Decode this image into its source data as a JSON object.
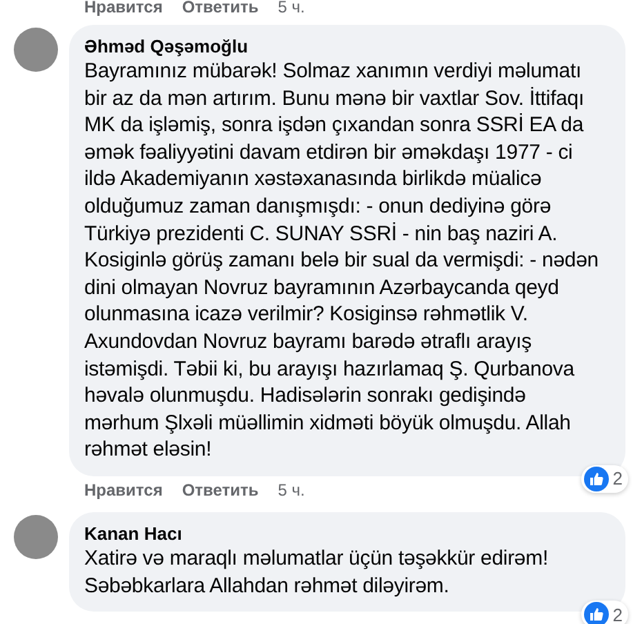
{
  "previous_actions": {
    "like": "Нравится",
    "reply": "Ответить",
    "time": "5 ч."
  },
  "comments": [
    {
      "author": "Əhməd Qəşəmoğlu",
      "text": "Bayramınız mübarək! Solmaz xanımın verdiyi məlumatı bir az da mən artırım. Bunu mənə bir vaxtlar Sov. İttifaqı MK da işləmiş, sonra işdən çıxandan sonra SSRİ EA da əmək fəaliyyətini davam etdirən bir əməkdaşı 1977 - ci ildə Akademiyanın xəstəxanasında birlikdə müalicə olduğumuz zaman danışmışdı: - onun dediyinə görə Türkiyə prezidenti C. SUNAY SSRİ - nin baş naziri A. Kosiginlə görüş zamanı belə bir sual da vermişdi: - nədən dini olmayan Novruz bayramının Azərbaycanda qeyd olunmasına icazə verilmir? Kosiginsə rəhmətlik V. Axundovdan Novruz bayramı barədə ətraflı arayış istəmişdi. Təbii ki, bu arayışı hazırlamaq Ş. Qurbanova həvalə olunmuşdu. Hadisələrin sonrakı gedişində mərhum Şlxəli müəllimin xidməti böyük olmuşdu. Allah rəhmət eləsin!",
      "reactions": "2",
      "actions": {
        "like": "Нравится",
        "reply": "Ответить",
        "time": "5 ч."
      }
    },
    {
      "author": "Kanan Hacı",
      "text": "Xatirə və maraqlı məlumatlar üçün təşəkkür edirəm! Səbəbkarlara Allahdan rəhmət diləyirəm.",
      "reactions": "2"
    }
  ]
}
